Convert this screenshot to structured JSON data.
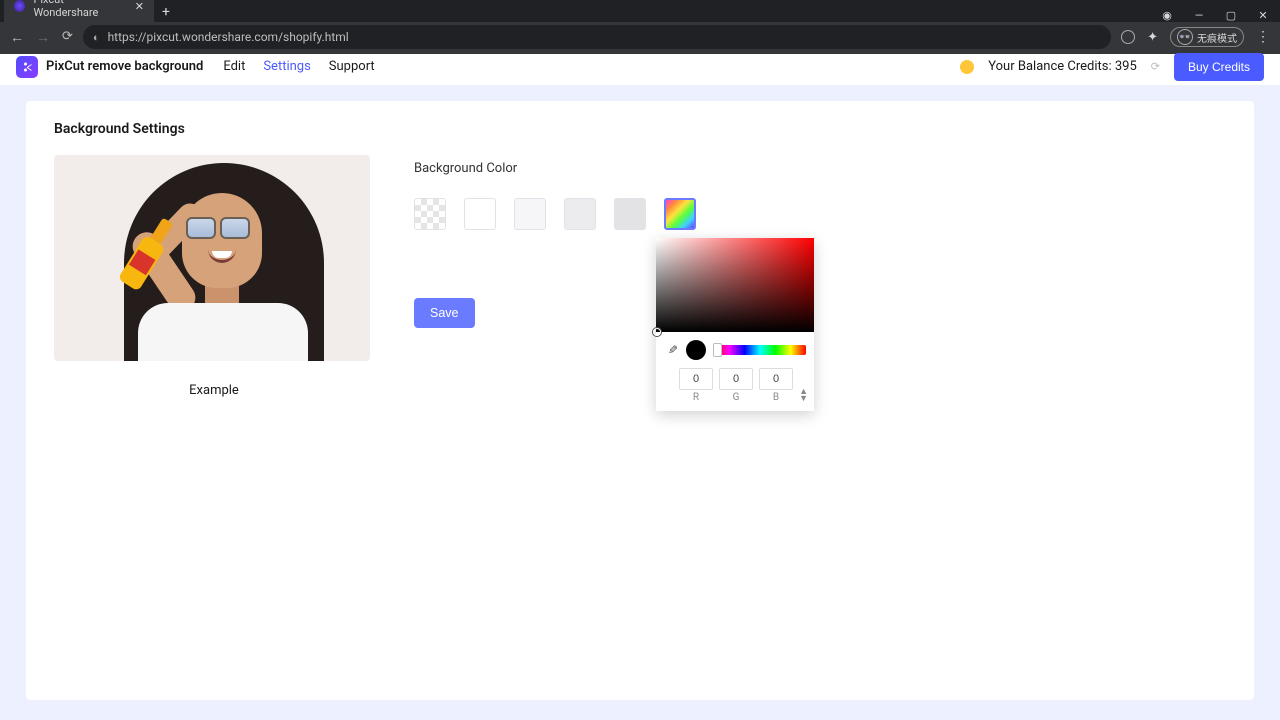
{
  "browser": {
    "tab_title": "Pixcut Wondershare",
    "url": "https://pixcut.wondershare.com/shopify.html",
    "incognito_label": "无痕模式"
  },
  "header": {
    "app_name": "PixCut remove background",
    "nav": {
      "edit": "Edit",
      "settings": "Settings",
      "support": "Support"
    },
    "balance_text": "Your Balance Credits: 395",
    "buy_label": "Buy Credits"
  },
  "page": {
    "section_title": "Background Settings",
    "example_label": "Example",
    "bgcolor_label": "Background Color",
    "save_label": "Save"
  },
  "picker": {
    "rgb": {
      "r": "0",
      "g": "0",
      "b": "0"
    },
    "labels": {
      "r": "R",
      "g": "G",
      "b": "B"
    }
  }
}
